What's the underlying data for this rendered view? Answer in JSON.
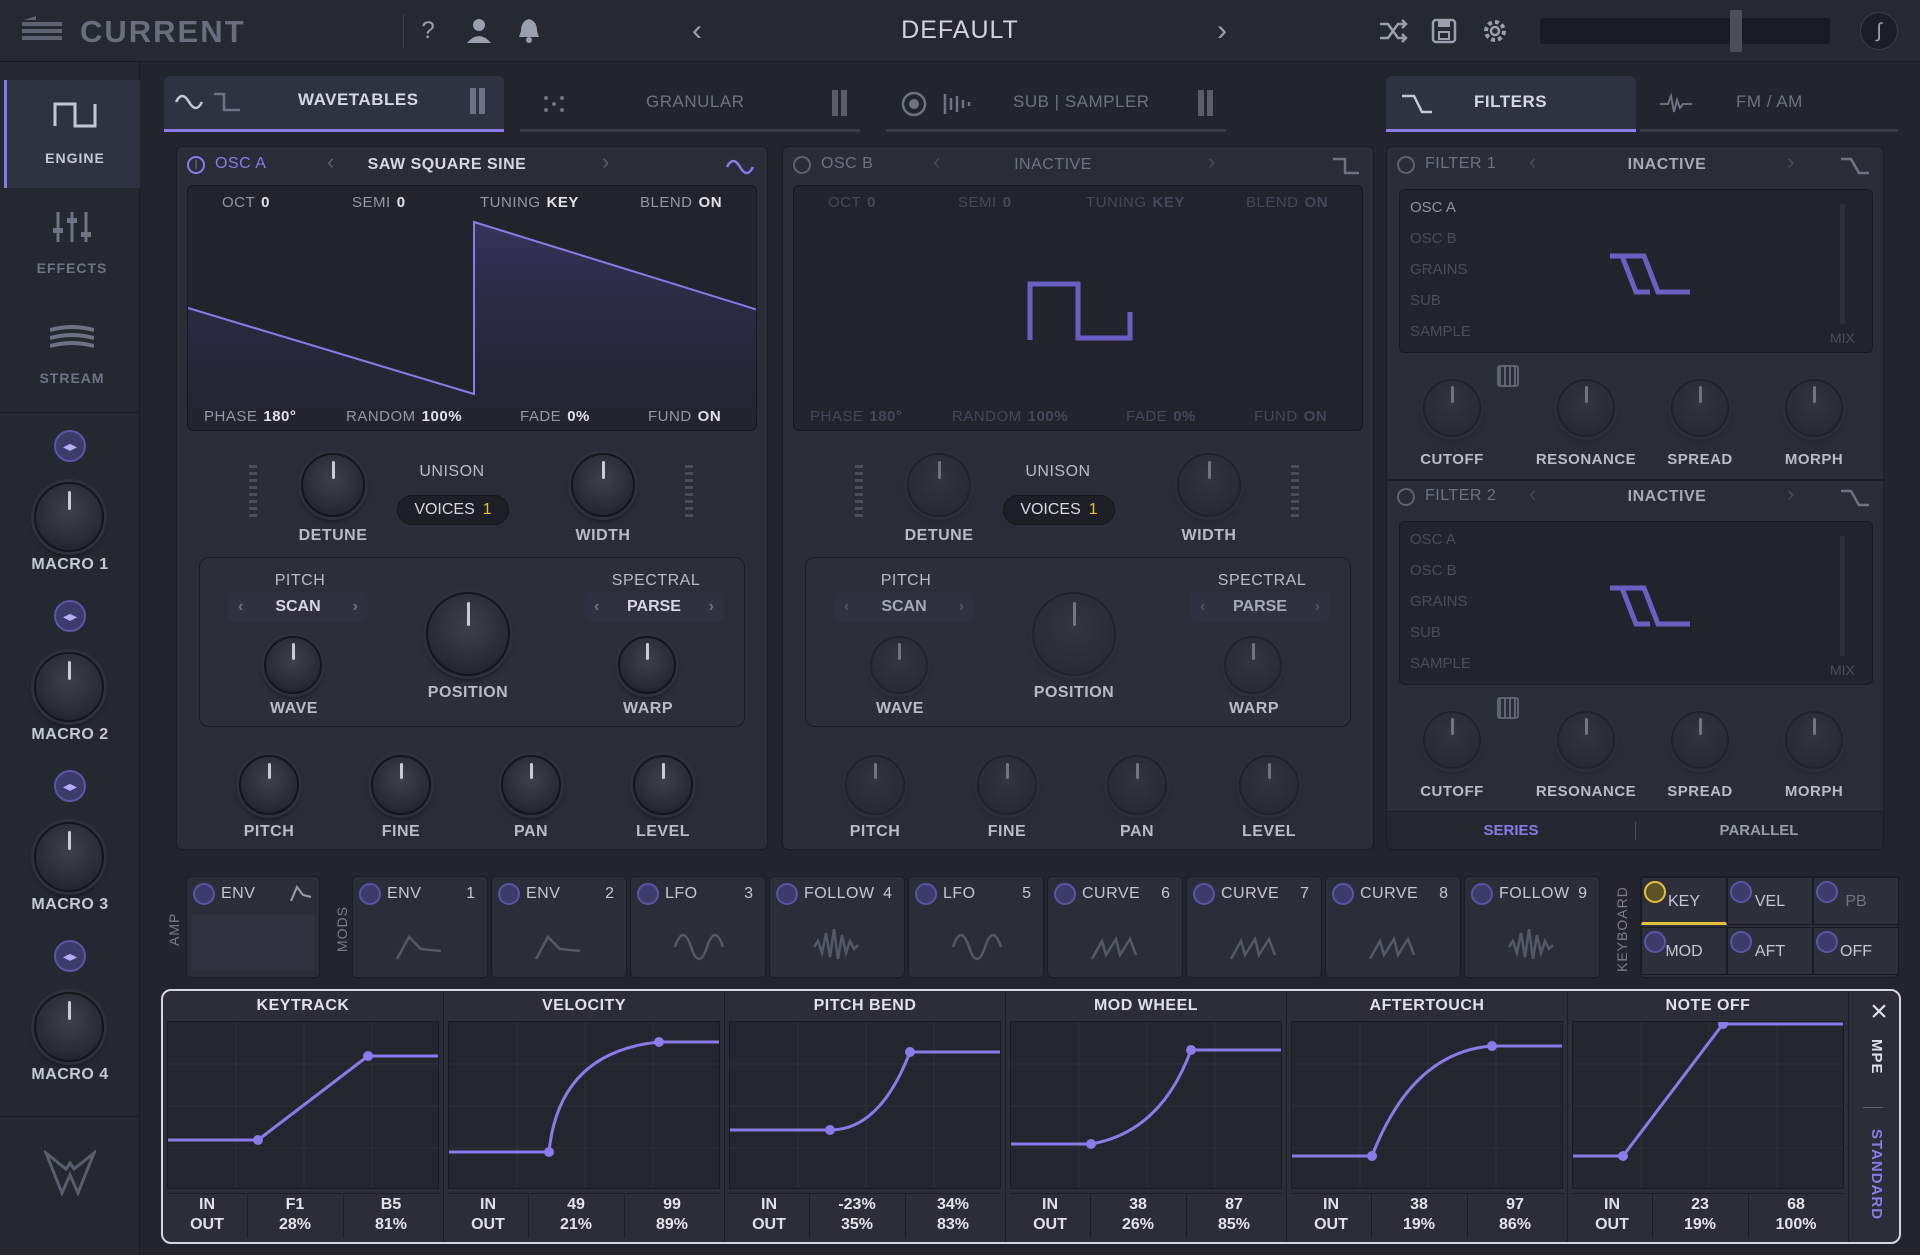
{
  "app": {
    "name": "CURRENT",
    "preset": "DEFAULT"
  },
  "sidebar": {
    "tabs": [
      "ENGINE",
      "EFFECTS",
      "STREAM"
    ],
    "macros": [
      "MACRO 1",
      "MACRO 2",
      "MACRO 3",
      "MACRO 4"
    ]
  },
  "engine_tabs": {
    "wavetables": "WAVETABLES",
    "granular": "GRANULAR",
    "sub_sampler": "SUB | SAMPLER",
    "filters": "FILTERS",
    "fm_am": "FM / AM"
  },
  "osc_a": {
    "name": "OSC A",
    "wave": "SAW SQUARE SINE",
    "oct_l": "OCT",
    "oct": "0",
    "semi_l": "SEMI",
    "semi": "0",
    "tuning_l": "TUNING",
    "tuning": "KEY",
    "blend_l": "BLEND",
    "blend": "ON",
    "phase_l": "PHASE",
    "phase": "180°",
    "random_l": "RANDOM",
    "random": "100%",
    "fade_l": "FADE",
    "fade": "0%",
    "fund_l": "FUND",
    "fund": "ON"
  },
  "osc_b": {
    "name": "OSC B",
    "wave": "INACTIVE",
    "oct_l": "OCT",
    "oct": "0",
    "semi_l": "SEMI",
    "semi": "0",
    "tuning_l": "TUNING",
    "tuning": "KEY",
    "blend_l": "BLEND",
    "blend": "ON",
    "phase_l": "PHASE",
    "phase": "180°",
    "random_l": "RANDOM",
    "random": "100%",
    "fade_l": "FADE",
    "fade": "0%",
    "fund_l": "FUND",
    "fund": "ON"
  },
  "unison": {
    "label": "UNISON",
    "voices_l": "VOICES",
    "voices": "1"
  },
  "knob_labels": {
    "detune": "DETUNE",
    "width": "WIDTH",
    "pitch_section": "PITCH",
    "spectral": "SPECTRAL",
    "scan": "SCAN",
    "parse": "PARSE",
    "wave": "WAVE",
    "position": "POSITION",
    "warp": "WARP",
    "pitch": "PITCH",
    "fine": "FINE",
    "pan": "PAN",
    "level": "LEVEL"
  },
  "filter1": {
    "name": "FILTER 1",
    "type": "INACTIVE",
    "sources": [
      "OSC A",
      "OSC B",
      "GRAINS",
      "SUB",
      "SAMPLE"
    ],
    "mix": "MIX"
  },
  "filter2": {
    "name": "FILTER 2",
    "type": "INACTIVE",
    "sources": [
      "OSC A",
      "OSC B",
      "GRAINS",
      "SUB",
      "SAMPLE"
    ],
    "mix": "MIX"
  },
  "filter_knobs": [
    "CUTOFF",
    "RESONANCE",
    "SPREAD",
    "MORPH"
  ],
  "routing": {
    "series": "SERIES",
    "parallel": "PARALLEL"
  },
  "amp": {
    "label": "AMP",
    "env": "ENV"
  },
  "mods": {
    "label": "MODS",
    "items": [
      {
        "name": "ENV",
        "num": "1"
      },
      {
        "name": "ENV",
        "num": "2"
      },
      {
        "name": "LFO",
        "num": "3"
      },
      {
        "name": "FOLLOW",
        "num": "4"
      },
      {
        "name": "LFO",
        "num": "5"
      },
      {
        "name": "CURVE",
        "num": "6"
      },
      {
        "name": "CURVE",
        "num": "7"
      },
      {
        "name": "CURVE",
        "num": "8"
      },
      {
        "name": "FOLLOW",
        "num": "9"
      }
    ]
  },
  "keyboard": {
    "label": "KEYBOARD",
    "buttons": [
      "KEY",
      "VEL",
      "PB",
      "MOD",
      "AFT",
      "OFF"
    ]
  },
  "curves": {
    "side_top": "MPE",
    "side_bottom": "STANDARD",
    "in_l": "IN",
    "out_l": "OUT",
    "items": [
      {
        "title": "KEYTRACK",
        "in1": "F1",
        "out1": "28%",
        "in2": "B5",
        "out2": "81%"
      },
      {
        "title": "VELOCITY",
        "in1": "49",
        "out1": "21%",
        "in2": "99",
        "out2": "89%"
      },
      {
        "title": "PITCH BEND",
        "in1": "-23%",
        "out1": "35%",
        "in2": "34%",
        "out2": "83%"
      },
      {
        "title": "MOD WHEEL",
        "in1": "38",
        "out1": "26%",
        "in2": "87",
        "out2": "85%"
      },
      {
        "title": "AFTERTOUCH",
        "in1": "38",
        "out1": "19%",
        "in2": "97",
        "out2": "86%"
      },
      {
        "title": "NOTE OFF",
        "in1": "23",
        "out1": "19%",
        "in2": "68",
        "out2": "100%"
      }
    ]
  },
  "colors": {
    "accent": "#8b7be8",
    "yellow": "#e3c13a"
  }
}
